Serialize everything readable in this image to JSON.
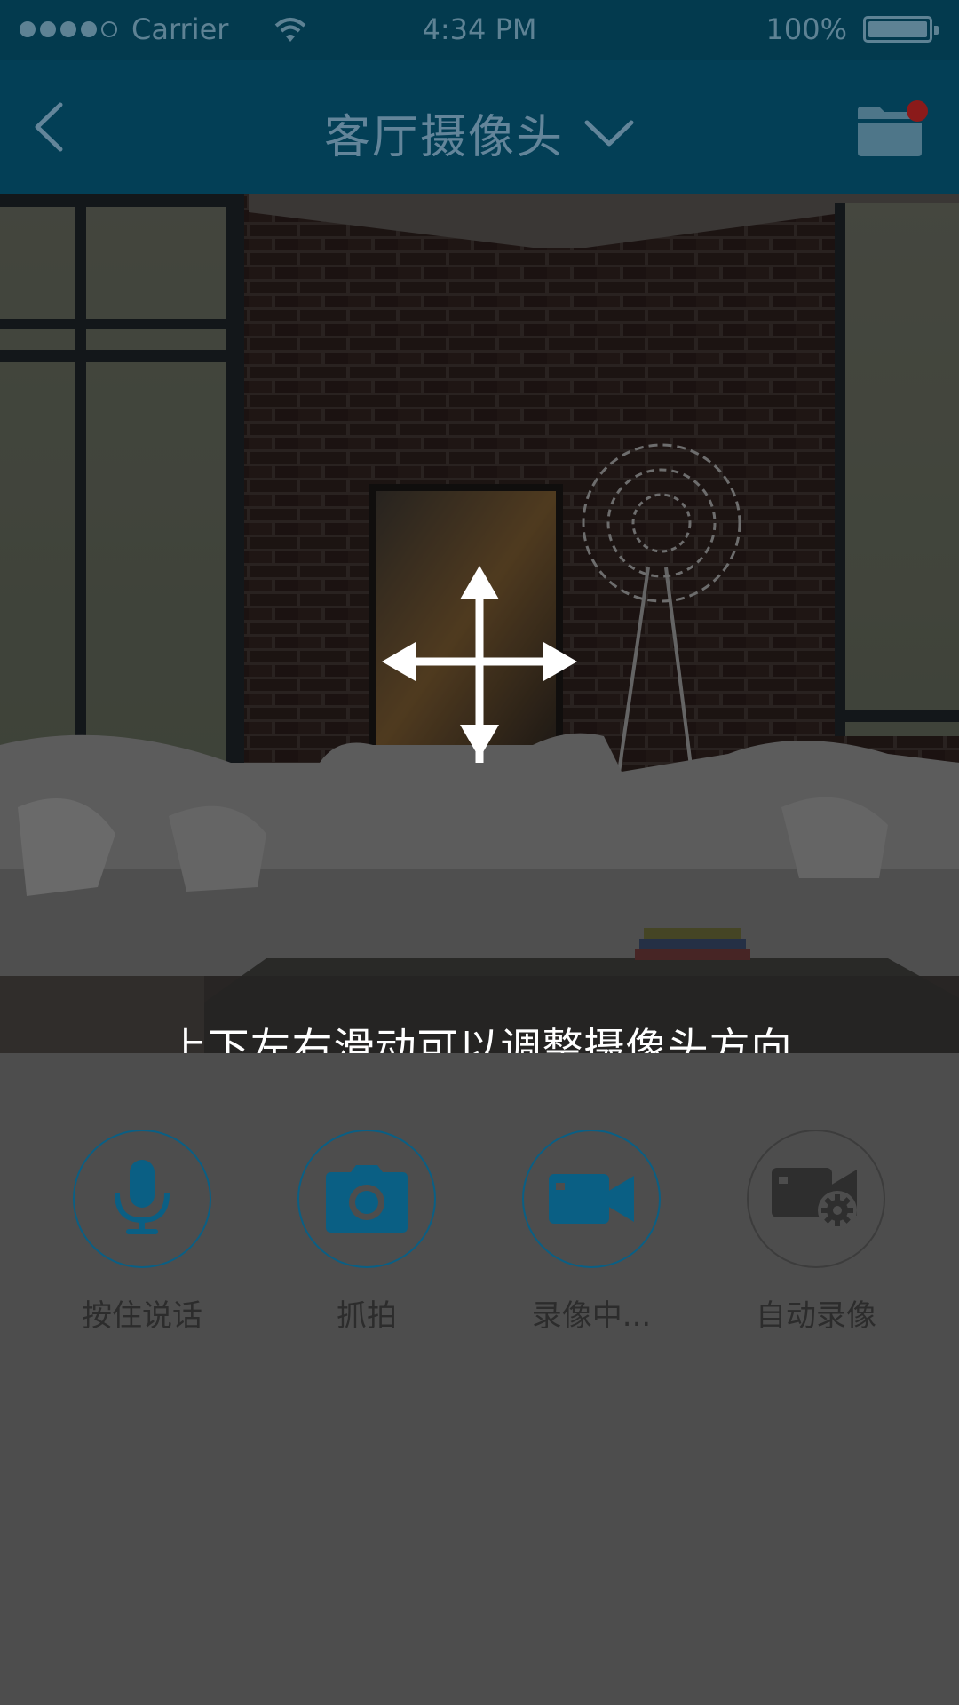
{
  "status_bar": {
    "carrier": "Carrier",
    "time": "4:34 PM",
    "battery": "100%"
  },
  "nav": {
    "title": "客厅摄像头",
    "back_icon": "back-chevron-icon",
    "dropdown_icon": "chevron-down-icon",
    "folder_icon": "folder-icon",
    "notification_color": "#8b1a1a"
  },
  "video": {
    "hint": "上下左右滑动可以调整摄像头方向",
    "gesture_icon": "move-arrows-icon"
  },
  "controls": [
    {
      "label": "按住说话",
      "icon": "microphone-icon"
    },
    {
      "label": "抓拍",
      "icon": "camera-icon"
    },
    {
      "label": "录像中...",
      "icon": "video-camera-icon"
    },
    {
      "label": "自动录像",
      "icon": "video-settings-icon"
    }
  ],
  "colors": {
    "header": "#033f56",
    "accent": "#0a5f84",
    "background": "#4d4d4d"
  }
}
